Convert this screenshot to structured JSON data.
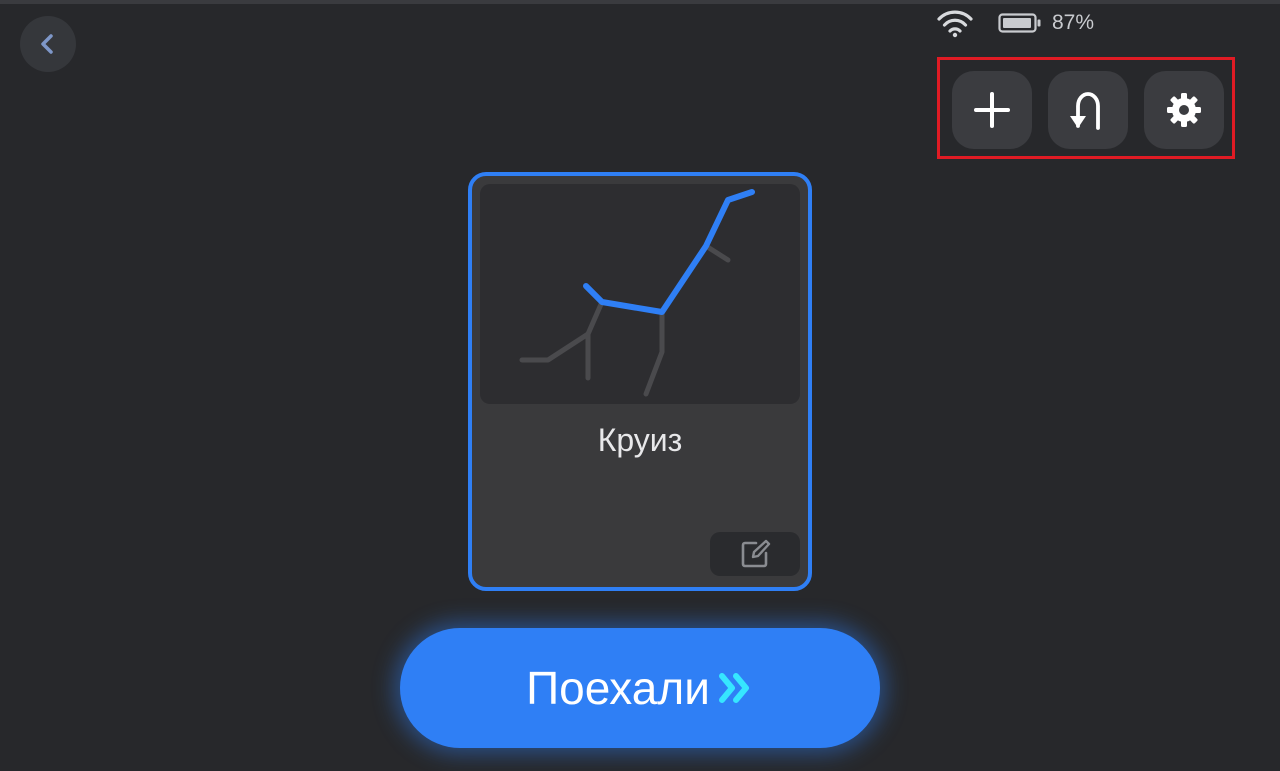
{
  "status": {
    "wifi_icon": "wifi-icon",
    "battery_icon": "battery-icon",
    "battery_percent": "87%"
  },
  "nav": {
    "back_icon": "chevron-left-icon"
  },
  "toolbar": {
    "add_icon": "plus-icon",
    "return_icon": "u-turn-arrow-icon",
    "settings_icon": "gear-icon"
  },
  "card": {
    "title": "Круиз",
    "edit_icon": "edit-icon",
    "map_route_color": "#2f7ff5",
    "map_path_color": "#4a4a4d"
  },
  "action": {
    "go_label": "Поехали",
    "go_icon": "double-chevron-right-icon",
    "accent": "#2f7ff5",
    "arrow_color": "#36e6ff"
  },
  "colors": {
    "background": "#27282b",
    "highlight_box": "#e01b24"
  }
}
